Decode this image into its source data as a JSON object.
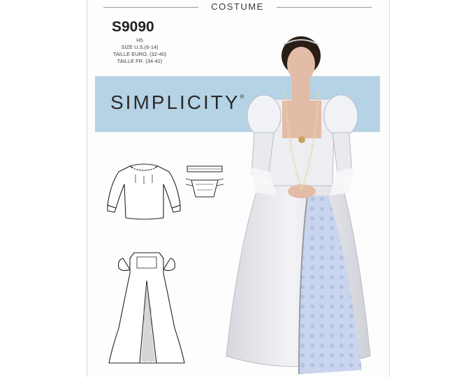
{
  "header": {
    "category": "COSTUME"
  },
  "pattern": {
    "number": "S9090",
    "size_code": "H5",
    "size_us": "SIZE U.S.(6-14)",
    "size_euro": "TAILLE EURO. (32-40)",
    "size_fr": "TAILLE FR. (34-42)"
  },
  "brand": {
    "name": "SIMPLICITY",
    "mark": "®"
  },
  "colors": {
    "band": "#b6d3e6",
    "gown": "#e9eaee",
    "underskirt": "#c7d3ec",
    "hair": "#2a1d17",
    "skin": "#e2bca6"
  },
  "views": [
    "blouse-sketch",
    "bodice-piece-sketches",
    "gown-sketch",
    "model-photo"
  ]
}
